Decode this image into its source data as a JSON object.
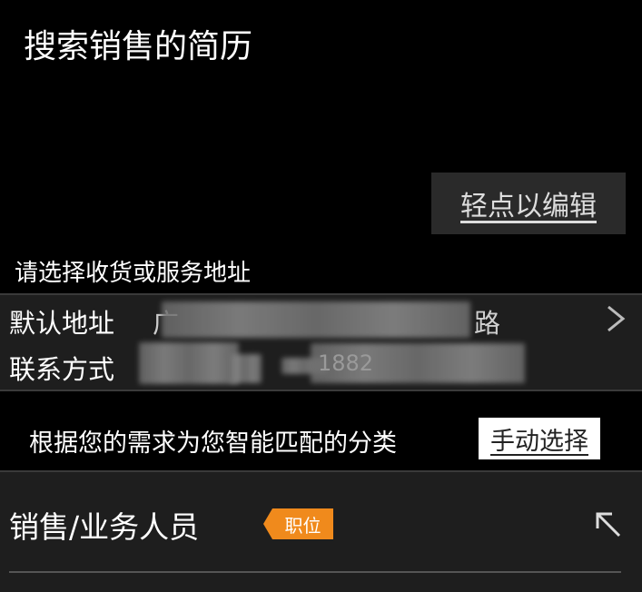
{
  "page": {
    "title": "搜索销售的简历"
  },
  "edit_button": {
    "label": "轻点以编辑"
  },
  "address": {
    "prompt": "请选择收货或服务地址",
    "default_label": "默认地址",
    "default_value_visible": "广",
    "default_value_suffix": "路",
    "contact_label": "联系方式",
    "contact_value_visible": "1882"
  },
  "match": {
    "text": "根据您的需求为您智能匹配的分类",
    "manual_button": "手动选择"
  },
  "job": {
    "label": "销售/业务人员",
    "badge": "职位"
  },
  "icons": {
    "chevron": "chevron-right-icon",
    "expand": "arrow-up-left-icon"
  }
}
